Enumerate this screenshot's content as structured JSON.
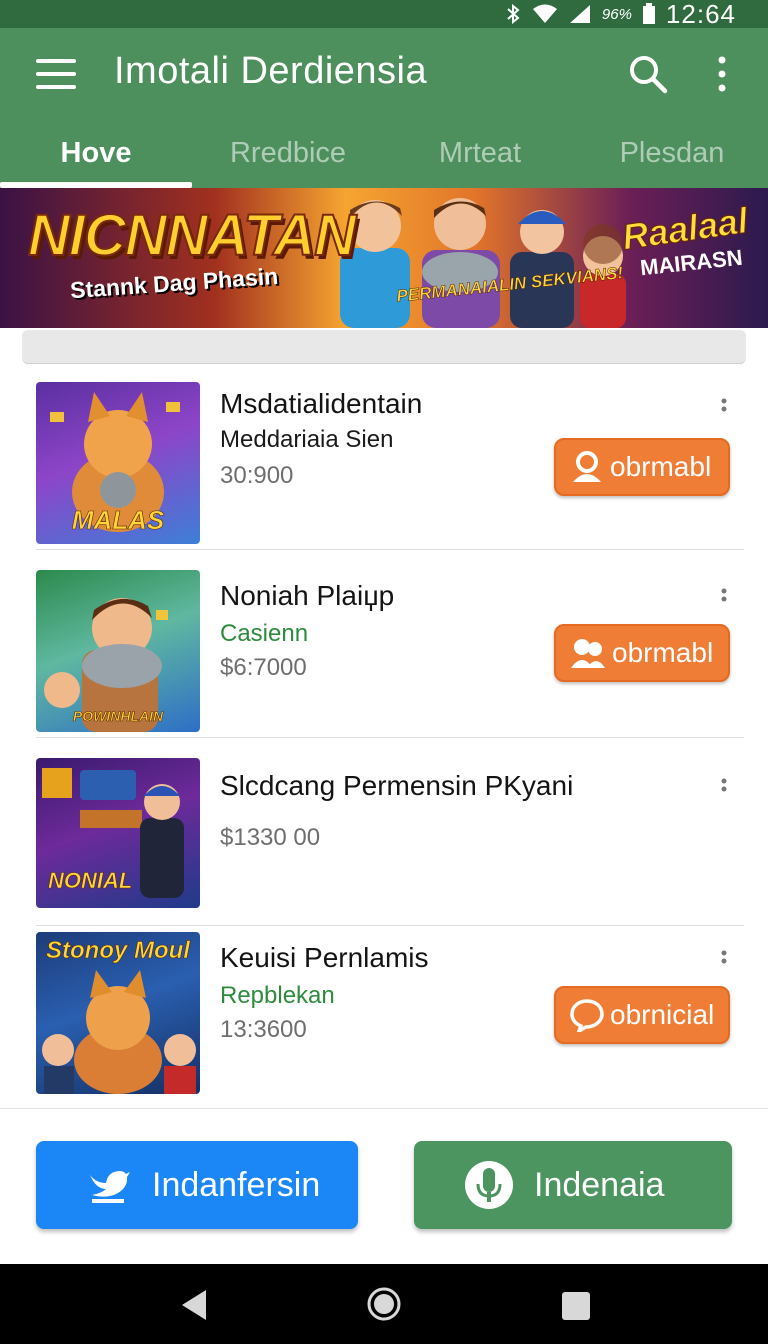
{
  "status_bar": {
    "battery": "96%",
    "time": "12:64"
  },
  "app_bar": {
    "title": "Imotali Derdiensia"
  },
  "tabs": [
    {
      "label": "Hove",
      "active": true
    },
    {
      "label": "Rredbice",
      "active": false
    },
    {
      "label": "Mrteat",
      "active": false
    },
    {
      "label": "Plesdan",
      "active": false
    }
  ],
  "banner": {
    "title_left": "NICNNATAN",
    "subtitle_left": "Stannk Dag Phasin",
    "title_right": "Raalaal",
    "subtitle_right": "MAIRASN",
    "center_text": "PERMANAIALIN SEKVIANS!"
  },
  "items": [
    {
      "title": "Msdatialidentain",
      "subtitle": "Meddariaia Sien",
      "subtitle_color": "dark",
      "price": "30:900",
      "thumb_label": "MALAS",
      "button": {
        "label": "obrmabl",
        "icon": "person-icon"
      }
    },
    {
      "title": "Noniah Plaiџp",
      "subtitle": "Casienn",
      "subtitle_color": "green",
      "price": "$6:7000",
      "thumb_label": "POWINHLAIN",
      "button": {
        "label": "obrmabl",
        "icon": "people-icon"
      }
    },
    {
      "title": "Slcdcang Permensin PKyani",
      "subtitle": "",
      "price": "$1330 00",
      "thumb_label": "NONIAL",
      "button": null
    },
    {
      "title": "Keuisi Pernlamis",
      "subtitle": "Repblekan",
      "subtitle_color": "green",
      "price": "13:3600",
      "thumb_label": "Stonoy Moul",
      "button": {
        "label": "obrnicial",
        "icon": "chat-bubble-icon"
      }
    }
  ],
  "bottom": {
    "left_button": {
      "label": "Indanfersin",
      "icon": "bird-icon",
      "color": "#1b86f5"
    },
    "right_button": {
      "label": "Indenaia",
      "icon": "mic-icon",
      "color": "#4c9560"
    }
  },
  "colors": {
    "app_bar": "#4d8f5d",
    "status_bar": "#2f6b3f",
    "accent_orange": "#f07d35"
  }
}
